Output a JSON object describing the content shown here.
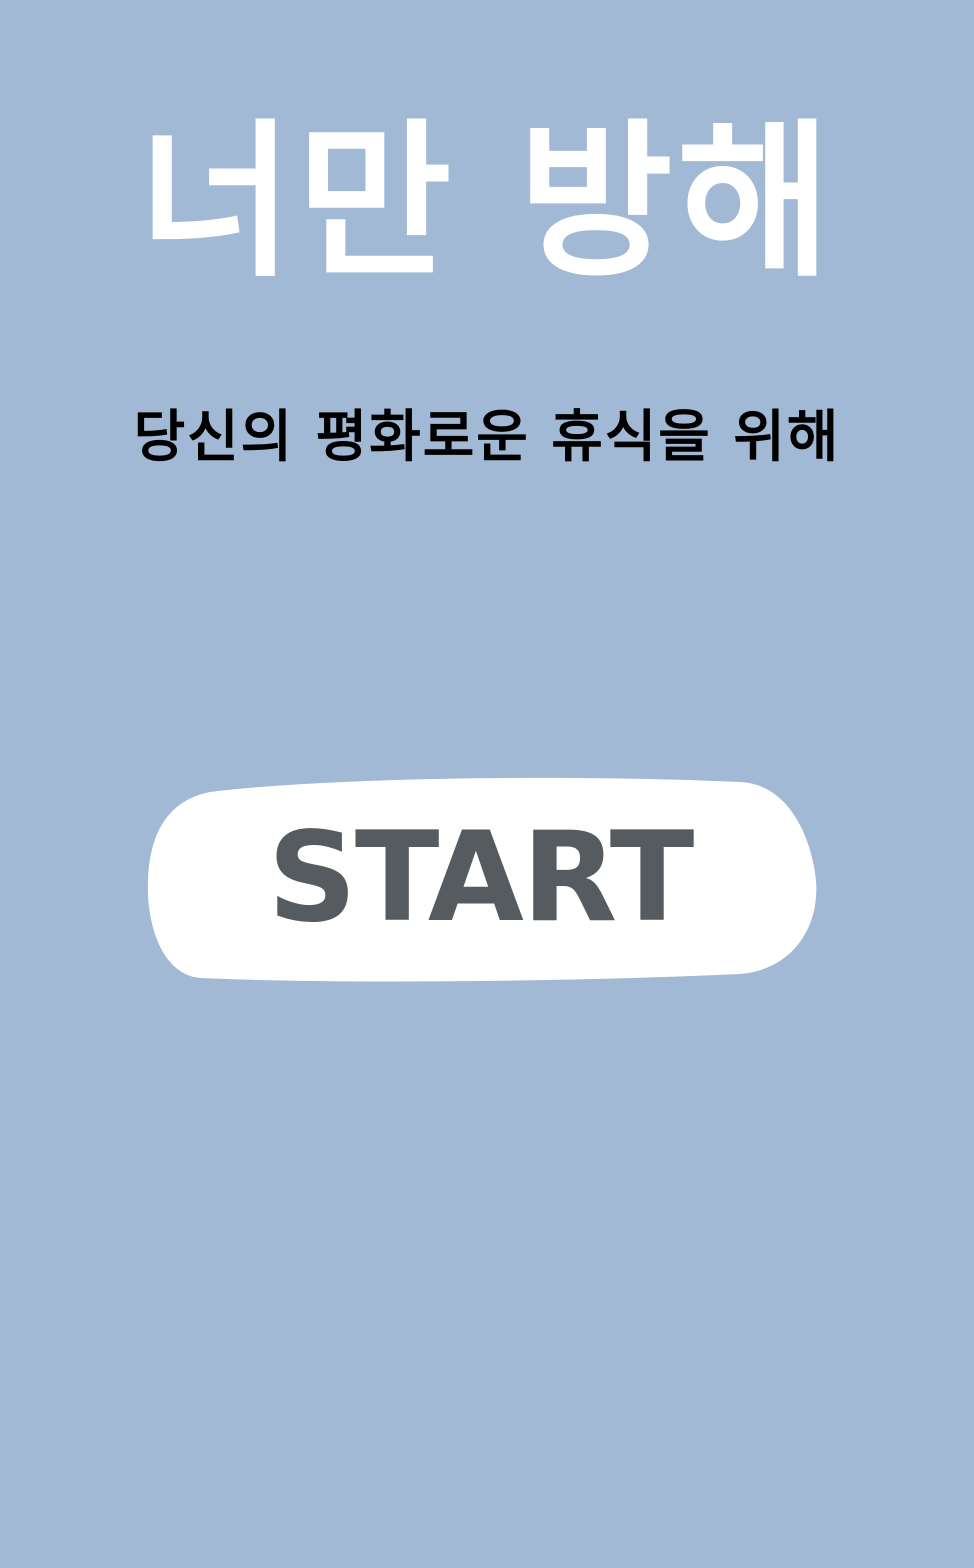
{
  "colors": {
    "background": "#a2b9d5",
    "title": "#ffffff",
    "subtitle": "#000000",
    "button_fill": "#ffffff",
    "button_text": "#555b5e"
  },
  "title": "너만 방해",
  "subtitle": "당신의 평화로운 휴식을 위해",
  "start_button": {
    "label": "START"
  }
}
